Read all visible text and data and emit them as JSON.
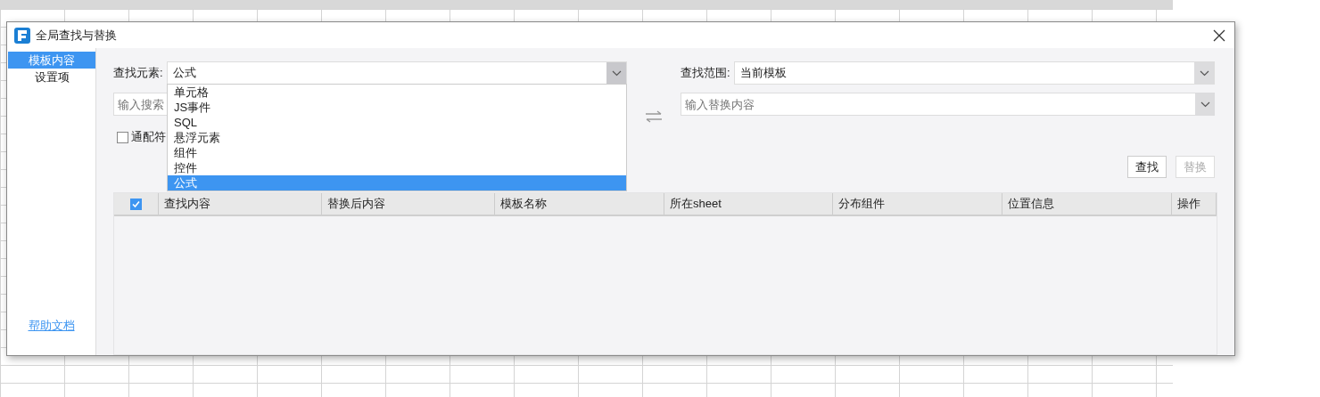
{
  "window": {
    "title": "全局查找与替换"
  },
  "sidebar": {
    "items": [
      {
        "label": "模板内容",
        "selected": true
      },
      {
        "label": "设置项",
        "selected": false
      }
    ],
    "help_link": "帮助文档"
  },
  "find_element": {
    "label": "查找元素:",
    "value": "公式",
    "expanded": true,
    "options": [
      {
        "label": "单元格",
        "selected": false
      },
      {
        "label": "JS事件",
        "selected": false
      },
      {
        "label": "SQL",
        "selected": false
      },
      {
        "label": "悬浮元素",
        "selected": false
      },
      {
        "label": "组件",
        "selected": false
      },
      {
        "label": "控件",
        "selected": false
      },
      {
        "label": "公式",
        "selected": true
      }
    ]
  },
  "search": {
    "placeholder": "输入搜索"
  },
  "wildcard": {
    "label": "通配符",
    "checked": false
  },
  "find_scope": {
    "label": "查找范围:",
    "value": "当前模板"
  },
  "replace": {
    "placeholder": "输入替换内容"
  },
  "buttons": [
    {
      "label": "查找",
      "disabled": false
    },
    {
      "label": "替换",
      "disabled": true
    }
  ],
  "table": {
    "select_all_checked": true,
    "columns": [
      "查找内容",
      "替换后内容",
      "模板名称",
      "所在sheet",
      "分布组件",
      "位置信息",
      "操作"
    ]
  }
}
